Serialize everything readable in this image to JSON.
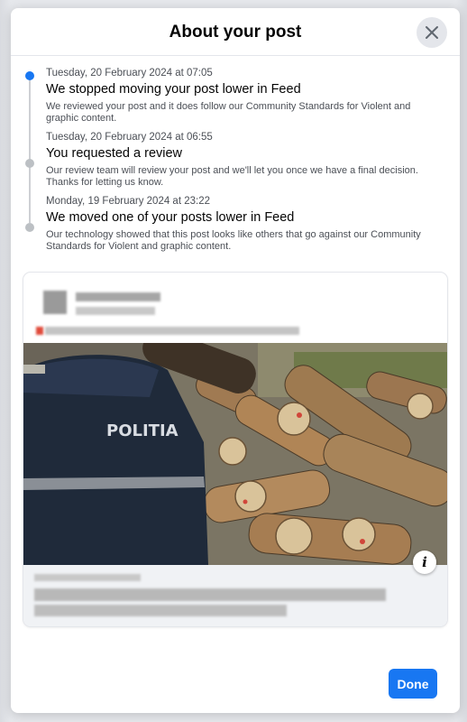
{
  "dialog": {
    "title": "About your post",
    "close_icon": "close-icon",
    "done_label": "Done"
  },
  "timeline": [
    {
      "date": "Tuesday, 20 February 2024 at 07:05",
      "title": "We stopped moving your post lower in Feed",
      "body": "We reviewed your post and it does follow our Community Standards for Violent and graphic content.",
      "active": true
    },
    {
      "date": "Tuesday, 20 February 2024 at 06:55",
      "title": "You requested a review",
      "body": "Our review team will review your post and we'll let you once we have a final decision. Thanks for letting us know.",
      "active": false
    },
    {
      "date": "Monday, 19 February 2024 at 23:22",
      "title": "We moved one of your posts lower in Feed",
      "body": "Our technology showed that this post looks like others that go against our Community Standards for Violent and graphic content.",
      "active": false
    }
  ],
  "post": {
    "image_badge_text": "POLITIA",
    "info_icon": "info-icon"
  },
  "colors": {
    "accent": "#1877f2",
    "inactive_dot": "#bcc0c4",
    "footer_bg": "#f0f2f5"
  }
}
